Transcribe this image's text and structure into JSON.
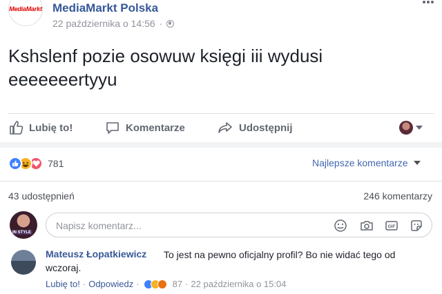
{
  "header": {
    "page_logo_text": "MediaMarkt",
    "page_name": "MediaMarkt Polska",
    "timestamp": "22 października o 14:56",
    "separator": "·",
    "privacy_icon": "globe-icon",
    "options_icon": "chevron-down-icon"
  },
  "post": {
    "text": "Kshslenf pozie osowuw księgi iii wydusi eeeeeeertyyu"
  },
  "actions": {
    "like_label": "Lubię to!",
    "comment_label": "Komentarze",
    "share_label": "Udostępnij",
    "like_icon": "thumbs-up-icon",
    "comment_icon": "speech-bubble-icon",
    "share_icon": "share-arrow-icon"
  },
  "reactions": {
    "types": [
      "like",
      "haha",
      "love"
    ],
    "count": "781"
  },
  "sort": {
    "label": "Najlepsze komentarze"
  },
  "stats": {
    "shares": "43 udostępnień",
    "comments": "246 komentarzy"
  },
  "composer": {
    "placeholder": "Napisz komentarz...",
    "icons": [
      "emoji-icon",
      "camera-icon",
      "gif-icon",
      "sticker-icon"
    ]
  },
  "comment": {
    "author": "Mateusz Łopatkiewicz",
    "text": "To jest na pewno oficjalny profil? Bo nie widać tego od wczoraj.",
    "like_label": "Lubię to!",
    "reply_label": "Odpowiedz",
    "sep": "·",
    "reaction_types": [
      "like",
      "haha",
      "angry"
    ],
    "reaction_count": "87",
    "timestamp": "22 października o 15:04"
  },
  "colors": {
    "link": "#365899",
    "brand_red": "#df0000",
    "muted": "#90949c",
    "like_blue": "#4080ff",
    "love_red": "#f25268",
    "haha_yellow": "#f7b125"
  }
}
